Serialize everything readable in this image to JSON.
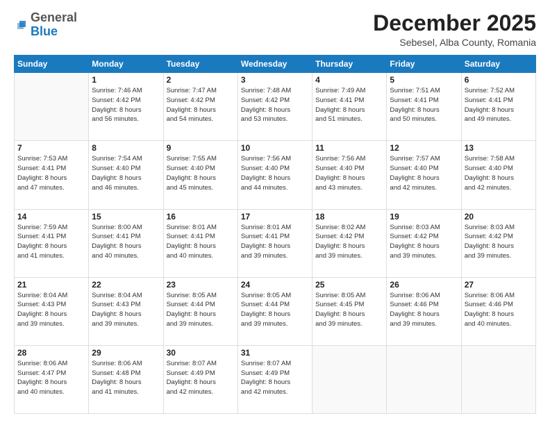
{
  "header": {
    "logo_line1": "General",
    "logo_line2": "Blue",
    "month": "December 2025",
    "location": "Sebesel, Alba County, Romania"
  },
  "days_of_week": [
    "Sunday",
    "Monday",
    "Tuesday",
    "Wednesday",
    "Thursday",
    "Friday",
    "Saturday"
  ],
  "weeks": [
    [
      {
        "day": "",
        "info": ""
      },
      {
        "day": "1",
        "info": "Sunrise: 7:46 AM\nSunset: 4:42 PM\nDaylight: 8 hours\nand 56 minutes."
      },
      {
        "day": "2",
        "info": "Sunrise: 7:47 AM\nSunset: 4:42 PM\nDaylight: 8 hours\nand 54 minutes."
      },
      {
        "day": "3",
        "info": "Sunrise: 7:48 AM\nSunset: 4:42 PM\nDaylight: 8 hours\nand 53 minutes."
      },
      {
        "day": "4",
        "info": "Sunrise: 7:49 AM\nSunset: 4:41 PM\nDaylight: 8 hours\nand 51 minutes."
      },
      {
        "day": "5",
        "info": "Sunrise: 7:51 AM\nSunset: 4:41 PM\nDaylight: 8 hours\nand 50 minutes."
      },
      {
        "day": "6",
        "info": "Sunrise: 7:52 AM\nSunset: 4:41 PM\nDaylight: 8 hours\nand 49 minutes."
      }
    ],
    [
      {
        "day": "7",
        "info": "Sunrise: 7:53 AM\nSunset: 4:41 PM\nDaylight: 8 hours\nand 47 minutes."
      },
      {
        "day": "8",
        "info": "Sunrise: 7:54 AM\nSunset: 4:40 PM\nDaylight: 8 hours\nand 46 minutes."
      },
      {
        "day": "9",
        "info": "Sunrise: 7:55 AM\nSunset: 4:40 PM\nDaylight: 8 hours\nand 45 minutes."
      },
      {
        "day": "10",
        "info": "Sunrise: 7:56 AM\nSunset: 4:40 PM\nDaylight: 8 hours\nand 44 minutes."
      },
      {
        "day": "11",
        "info": "Sunrise: 7:56 AM\nSunset: 4:40 PM\nDaylight: 8 hours\nand 43 minutes."
      },
      {
        "day": "12",
        "info": "Sunrise: 7:57 AM\nSunset: 4:40 PM\nDaylight: 8 hours\nand 42 minutes."
      },
      {
        "day": "13",
        "info": "Sunrise: 7:58 AM\nSunset: 4:40 PM\nDaylight: 8 hours\nand 42 minutes."
      }
    ],
    [
      {
        "day": "14",
        "info": "Sunrise: 7:59 AM\nSunset: 4:41 PM\nDaylight: 8 hours\nand 41 minutes."
      },
      {
        "day": "15",
        "info": "Sunrise: 8:00 AM\nSunset: 4:41 PM\nDaylight: 8 hours\nand 40 minutes."
      },
      {
        "day": "16",
        "info": "Sunrise: 8:01 AM\nSunset: 4:41 PM\nDaylight: 8 hours\nand 40 minutes."
      },
      {
        "day": "17",
        "info": "Sunrise: 8:01 AM\nSunset: 4:41 PM\nDaylight: 8 hours\nand 39 minutes."
      },
      {
        "day": "18",
        "info": "Sunrise: 8:02 AM\nSunset: 4:42 PM\nDaylight: 8 hours\nand 39 minutes."
      },
      {
        "day": "19",
        "info": "Sunrise: 8:03 AM\nSunset: 4:42 PM\nDaylight: 8 hours\nand 39 minutes."
      },
      {
        "day": "20",
        "info": "Sunrise: 8:03 AM\nSunset: 4:42 PM\nDaylight: 8 hours\nand 39 minutes."
      }
    ],
    [
      {
        "day": "21",
        "info": "Sunrise: 8:04 AM\nSunset: 4:43 PM\nDaylight: 8 hours\nand 39 minutes."
      },
      {
        "day": "22",
        "info": "Sunrise: 8:04 AM\nSunset: 4:43 PM\nDaylight: 8 hours\nand 39 minutes."
      },
      {
        "day": "23",
        "info": "Sunrise: 8:05 AM\nSunset: 4:44 PM\nDaylight: 8 hours\nand 39 minutes."
      },
      {
        "day": "24",
        "info": "Sunrise: 8:05 AM\nSunset: 4:44 PM\nDaylight: 8 hours\nand 39 minutes."
      },
      {
        "day": "25",
        "info": "Sunrise: 8:05 AM\nSunset: 4:45 PM\nDaylight: 8 hours\nand 39 minutes."
      },
      {
        "day": "26",
        "info": "Sunrise: 8:06 AM\nSunset: 4:46 PM\nDaylight: 8 hours\nand 39 minutes."
      },
      {
        "day": "27",
        "info": "Sunrise: 8:06 AM\nSunset: 4:46 PM\nDaylight: 8 hours\nand 40 minutes."
      }
    ],
    [
      {
        "day": "28",
        "info": "Sunrise: 8:06 AM\nSunset: 4:47 PM\nDaylight: 8 hours\nand 40 minutes."
      },
      {
        "day": "29",
        "info": "Sunrise: 8:06 AM\nSunset: 4:48 PM\nDaylight: 8 hours\nand 41 minutes."
      },
      {
        "day": "30",
        "info": "Sunrise: 8:07 AM\nSunset: 4:49 PM\nDaylight: 8 hours\nand 42 minutes."
      },
      {
        "day": "31",
        "info": "Sunrise: 8:07 AM\nSunset: 4:49 PM\nDaylight: 8 hours\nand 42 minutes."
      },
      {
        "day": "",
        "info": ""
      },
      {
        "day": "",
        "info": ""
      },
      {
        "day": "",
        "info": ""
      }
    ]
  ]
}
